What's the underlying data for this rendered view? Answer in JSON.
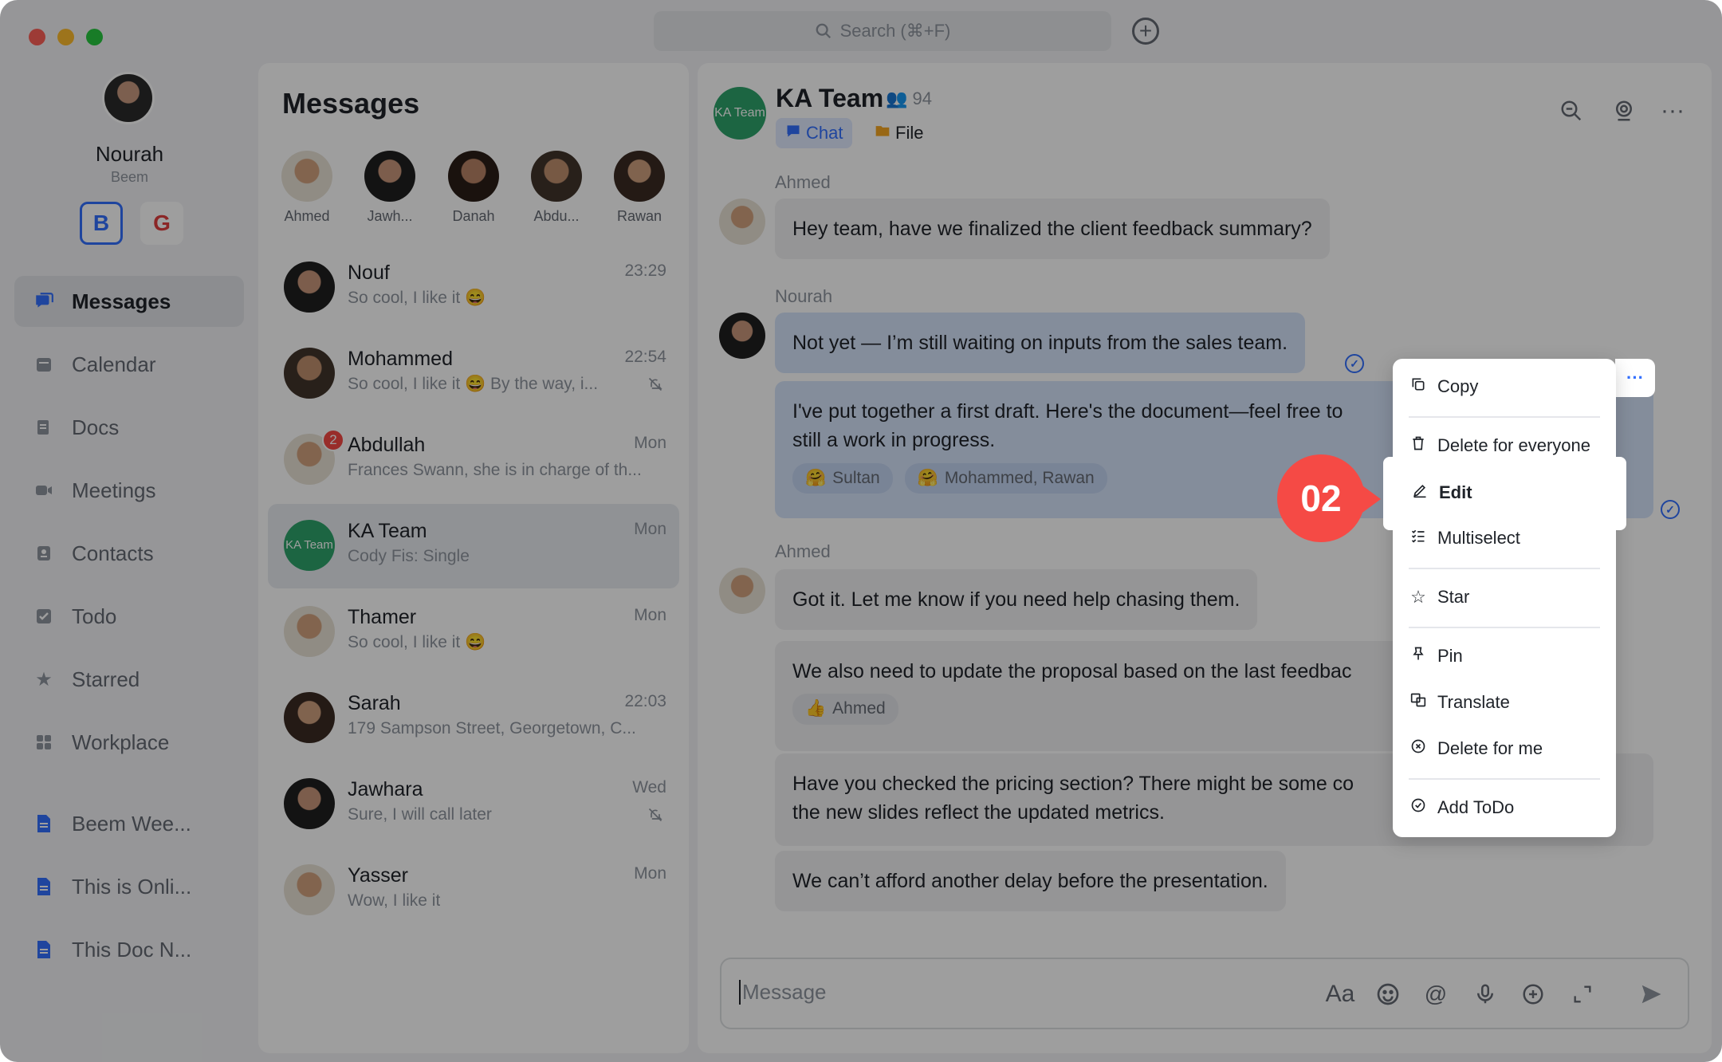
{
  "titlebar": {
    "search_placeholder": "Search (⌘+F)",
    "traffic_colors": [
      "#fe5f57",
      "#febc2e",
      "#28c840"
    ]
  },
  "profile": {
    "name": "Nourah",
    "org": "Beem",
    "workspaces": [
      "B",
      "G"
    ]
  },
  "sidebar": {
    "items": [
      {
        "label": "Messages",
        "icon": "chat-bubbles-icon",
        "active": true
      },
      {
        "label": "Calendar",
        "icon": "calendar-icon"
      },
      {
        "label": "Docs",
        "icon": "docs-icon"
      },
      {
        "label": "Meetings",
        "icon": "video-camera-icon"
      },
      {
        "label": "Contacts",
        "icon": "contacts-icon"
      },
      {
        "label": "Todo",
        "icon": "checkbox-icon"
      },
      {
        "label": "Starred",
        "icon": "star-icon"
      },
      {
        "label": "Workplace",
        "icon": "grid-icon"
      }
    ],
    "docs": [
      {
        "label": "Beem Wee..."
      },
      {
        "label": "This is Onli..."
      },
      {
        "label": "This Doc N..."
      }
    ]
  },
  "messages_panel": {
    "title": "Messages",
    "stories": [
      {
        "name": "Ahmed"
      },
      {
        "name": "Jawh..."
      },
      {
        "name": "Danah"
      },
      {
        "name": "Abdu..."
      },
      {
        "name": "Rawan"
      }
    ],
    "chats": [
      {
        "name": "Nouf",
        "preview": "So cool, I like it 😄",
        "time": "23:29"
      },
      {
        "name": "Mohammed",
        "preview": "So cool, I like it 😄 By the way, i...",
        "time": "22:54",
        "muted": true
      },
      {
        "name": "Abdullah",
        "preview": "Frances Swann, she is in charge of th...",
        "time": "Mon",
        "badge": "2"
      },
      {
        "name": "KA Team",
        "preview": "Cody Fis: Single",
        "time": "Mon",
        "avatar_text": "KA Team"
      },
      {
        "name": "Thamer",
        "preview": "So cool, I like it 😄",
        "time": "Mon"
      },
      {
        "name": "Sarah",
        "preview": "179 Sampson Street, Georgetown, C...",
        "time": "22:03"
      },
      {
        "name": "Jawhara",
        "preview": "Sure, I will call later",
        "time": "Wed",
        "muted": true
      },
      {
        "name": "Yasser",
        "preview": "Wow, I like it",
        "time": "Mon"
      }
    ]
  },
  "chat": {
    "avatar_text": "KA Team",
    "title": "KA Team",
    "member_count": "94",
    "tabs": {
      "chat": "Chat",
      "file": "File"
    },
    "messages": [
      {
        "sender": "Ahmed",
        "text": "Hey team, have we finalized the client feedback summary?"
      },
      {
        "sender": "Nourah",
        "text": "Not yet — I’m still waiting on inputs from the sales team."
      },
      {
        "text_line1": "I've put together a first draft. Here's the document—feel free to",
        "text_line2": "still a work in progress.",
        "reactions": [
          "Sultan",
          "Mohammed, Rawan"
        ]
      },
      {
        "sender": "Ahmed",
        "text": "Got it. Let me know if you need help chasing them."
      },
      {
        "text": "We also need to update the proposal based on the last feedbac",
        "reactions": [
          "Ahmed"
        ]
      },
      {
        "text_line1": "Have you checked the pricing section? There might be some co",
        "text_line2": "the new slides reflect the updated metrics."
      },
      {
        "text": "We can’t afford another delay before the presentation."
      }
    ],
    "input_placeholder": "Message",
    "input_icons": [
      "Aa"
    ]
  },
  "context_menu": {
    "items": [
      "Copy",
      "Delete for everyone",
      "Edit",
      "Multiselect",
      "Star",
      "Pin",
      "Translate",
      "Delete for me",
      "Add ToDo"
    ],
    "more": "···"
  },
  "annotation": {
    "step": "02",
    "color": "#f54a45"
  }
}
